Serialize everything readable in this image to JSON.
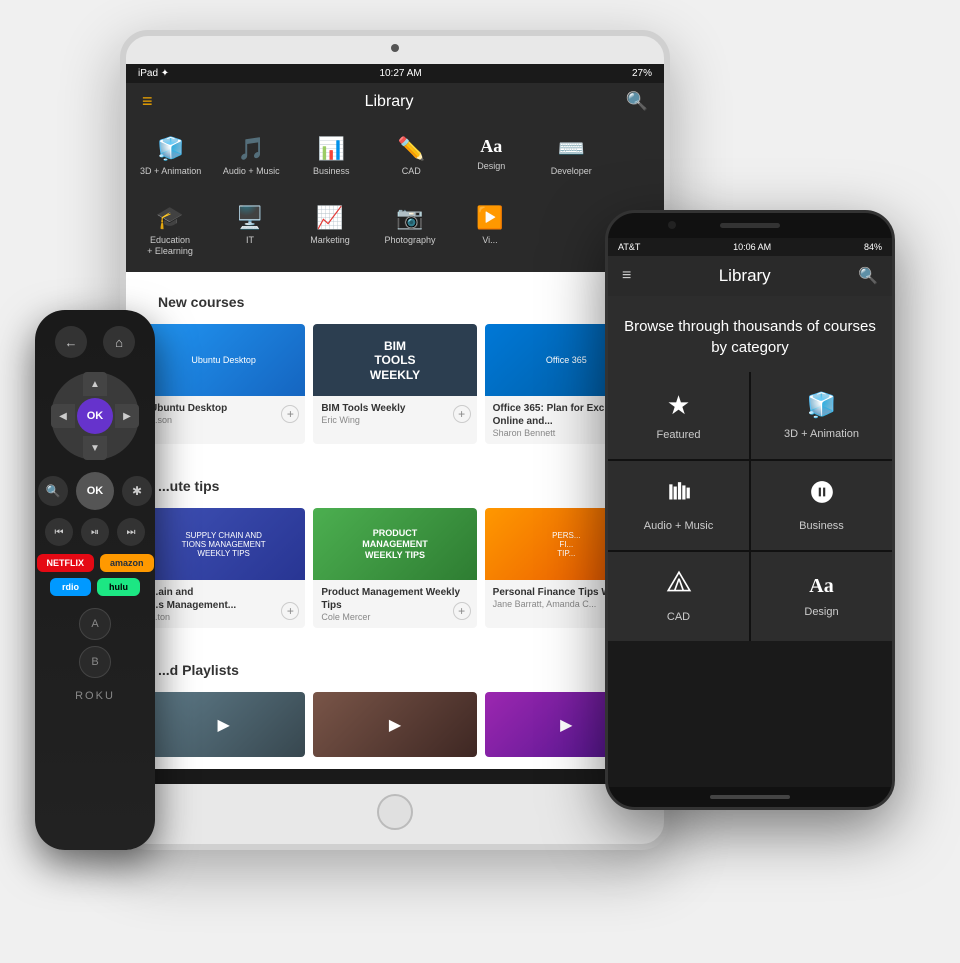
{
  "tablet": {
    "status_bar": {
      "carrier": "iPad ✦",
      "time": "10:27 AM",
      "battery": "27%",
      "icons": "🔋"
    },
    "nav": {
      "title": "Library"
    },
    "categories_row1": [
      {
        "icon": "🧊",
        "label": "3D + Animation"
      },
      {
        "icon": "🎵",
        "label": "Audio + Music"
      },
      {
        "icon": "📊",
        "label": "Business"
      },
      {
        "icon": "✏️",
        "label": "CAD"
      },
      {
        "icon": "Aa",
        "label": "Design"
      },
      {
        "icon": "⌨️",
        "label": "Developer"
      }
    ],
    "categories_row2": [
      {
        "icon": "🎓",
        "label": "Education\n+ Elearning"
      },
      {
        "icon": "🖥️",
        "label": "IT"
      },
      {
        "icon": "📈",
        "label": "Marketing"
      },
      {
        "icon": "📷",
        "label": "Photography"
      },
      {
        "icon": "▶️",
        "label": "Vi..."
      }
    ],
    "new_courses_title": "New courses",
    "courses": [
      {
        "title": "Ubuntu Desktop",
        "author": "...son",
        "img_type": "ubuntu"
      },
      {
        "title": "BIM Tools Weekly",
        "author": "Eric Wing",
        "img_type": "bim"
      },
      {
        "title": "Office 365: Plan for Exchange Online and...",
        "author": "Sharon Bennett",
        "img_type": "office"
      }
    ],
    "tips_title": "...ute tips",
    "tips": [
      {
        "title": "...pply Chain and\n...s Management...",
        "author": "...ton",
        "img_type": "supply"
      },
      {
        "title": "Product Management Weekly Tips",
        "author": "Cole Mercer",
        "img_type": "product"
      },
      {
        "title": "Personal Finance Tips Weekly",
        "author": "Jane Barratt, Amanda C...",
        "img_type": "personal"
      }
    ],
    "playlists_title": "...d Playlists"
  },
  "phone": {
    "status_bar": {
      "carrier": "AT&T",
      "time": "10:06 AM",
      "battery": "84%",
      "icons": "🔋"
    },
    "nav": {
      "title": "Library"
    },
    "browse_text": "Browse through thousands of courses by category",
    "categories": [
      {
        "icon": "★",
        "label": "Featured"
      },
      {
        "icon": "🧊",
        "label": "3D + Animation"
      },
      {
        "icon": "🎵",
        "label": "Audio + Music"
      },
      {
        "icon": "📊",
        "label": "Business"
      },
      {
        "icon": "✏️",
        "label": "CAD"
      },
      {
        "icon": "Aa",
        "label": "Design"
      }
    ]
  },
  "remote": {
    "logo": "ROKU",
    "back_label": "←",
    "home_label": "⌂",
    "ok_label": "OK",
    "dpad_up": "▲",
    "dpad_down": "▼",
    "dpad_left": "◀",
    "dpad_right": "▶",
    "search_icon": "🔍",
    "star_icon": "✱",
    "rewind_icon": "◀◀",
    "play_pause_icon": "▶❚❚",
    "fast_forward_icon": "▶▶",
    "netflix_label": "NETFLIX",
    "amazon_label": "amazon",
    "rdio_label": "rdio",
    "hulu_label": "hulu",
    "btn_a": "A",
    "btn_b": "B"
  }
}
